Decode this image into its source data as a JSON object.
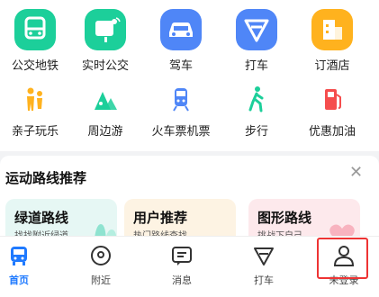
{
  "grid_row1": [
    {
      "label": "公交地铁",
      "icon": "bus-icon",
      "color": "#1ccf9a"
    },
    {
      "label": "实时公交",
      "icon": "realtime-bus-icon",
      "color": "#1ccf9a"
    },
    {
      "label": "驾车",
      "icon": "car-icon",
      "color": "#4f86f7"
    },
    {
      "label": "打车",
      "icon": "taxi-icon",
      "color": "#4f86f7"
    },
    {
      "label": "订酒店",
      "icon": "hotel-icon",
      "color": "#ffb21e"
    }
  ],
  "grid_row2": [
    {
      "label": "亲子玩乐",
      "icon": "family-icon",
      "color": "#ffb21e"
    },
    {
      "label": "周边游",
      "icon": "nearby-trip-icon",
      "color": "#1ccf9a"
    },
    {
      "label": "火车票机票",
      "icon": "train-icon",
      "color": "#4f86f7"
    },
    {
      "label": "步行",
      "icon": "walk-icon",
      "color": "#1ccf9a"
    },
    {
      "label": "优惠加油",
      "icon": "fuel-icon",
      "color": "#f54d4d"
    }
  ],
  "routes": {
    "title": "运动路线推荐",
    "cards": [
      {
        "title": "绿道路线",
        "sub": "找找附近绿道",
        "bg": "#e6f7f4"
      },
      {
        "title": "用户推荐",
        "sub": "热门路线查找",
        "bg": "#fdf3e3"
      },
      {
        "title": "图形路线",
        "sub": "挑战下自己",
        "bg": "#fde9ec"
      }
    ]
  },
  "tabs": [
    {
      "label": "首页",
      "icon": "home-icon"
    },
    {
      "label": "附近",
      "icon": "location-icon"
    },
    {
      "label": "消息",
      "icon": "message-icon"
    },
    {
      "label": "打车",
      "icon": "taxi-tab-icon"
    },
    {
      "label": "未登录",
      "icon": "user-icon"
    }
  ],
  "colors": {
    "accent": "#1f7aff",
    "highlight": "#e33333"
  }
}
